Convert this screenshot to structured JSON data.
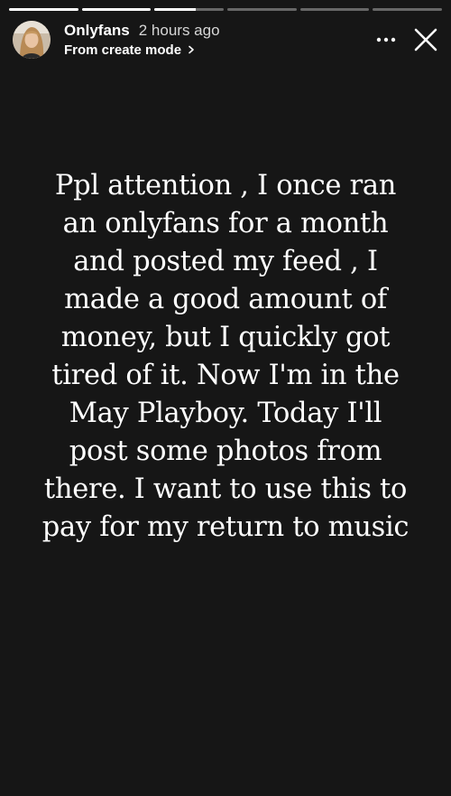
{
  "progress": {
    "segments": [
      1,
      1,
      0.6,
      0,
      0,
      0
    ]
  },
  "header": {
    "username": "Onlyfans",
    "timestamp": "2 hours ago",
    "subtitle": "From create mode",
    "avatar_icon": "user-avatar-icon",
    "more_icon": "more-horizontal-icon",
    "close_icon": "close-icon"
  },
  "story": {
    "text": "Ppl attention , I once ran\nan onlyfans for a month\nand posted my feed , I\nmade a good amount of\nmoney, but I quickly got\ntired of it. Now I'm in  the\nMay Playboy. Today I'll\npost some photos from\nthere. I want to use this to\npay for my return to music"
  },
  "colors": {
    "background": "#161616",
    "text": "#ffffff",
    "progress_track": "rgba(255,255,255,0.35)",
    "progress_fill": "#ffffff"
  }
}
